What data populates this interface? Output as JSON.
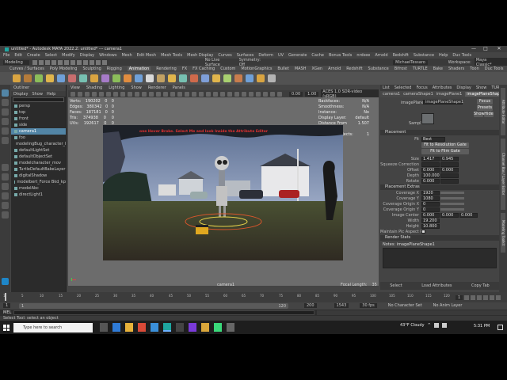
{
  "window": {
    "title": "untitled* - Autodesk MAYA 2022.2: untitled* --- camera1",
    "minimize": "—",
    "maximize": "□",
    "close": "✕"
  },
  "menubar": [
    "File",
    "Edit",
    "Create",
    "Select",
    "Modify",
    "Display",
    "Windows",
    "Mesh",
    "Edit Mesh",
    "Mesh Tools",
    "Mesh Display",
    "Curves",
    "Surfaces",
    "Deform",
    "UV",
    "Generate",
    "Cache",
    "Bonus Tools",
    "nrdsee",
    "Arnold",
    "Redshift",
    "Substance",
    "Help",
    "Duc Tools"
  ],
  "statusline": {
    "mode": "Modeling",
    "live_surface": "No Live Surface",
    "symmetry": "Symmetry: Off",
    "account": "MichaelTessaro",
    "workspace_label": "Workspace:",
    "workspace_value": "Maya Classic*"
  },
  "shelf_tabs": [
    "Curves / Surfaces",
    "Poly Modeling",
    "Sculpting",
    "Rigging",
    "Animation",
    "Rendering",
    "FX",
    "FX Caching",
    "Custom",
    "MotionGraphics",
    "Bullet",
    "MASH",
    "XGen",
    "Arnold",
    "Redshift",
    "Substance",
    "Bifrost",
    "TURTLE",
    "Bake",
    "Shaders",
    "Toon",
    "Duc Tools"
  ],
  "active_shelf": "Animation",
  "shelf_icon_colors": [
    "#d9a441",
    "#b47b3a",
    "#8bbd5a",
    "#e0b54c",
    "#6fa0d8",
    "#c86e6e",
    "#77c1b2",
    "#d9a441",
    "#a67bc8",
    "#8bbd5a",
    "#e08c3f",
    "#6fa0d8",
    "#d9d9d9",
    "#c2a163",
    "#e0b54c",
    "#77c1b2",
    "#d06a4b",
    "#7f9fd8",
    "#e0b54c",
    "#a8d070",
    "#c87d4d",
    "#6fa0d8",
    "#d9a441",
    "#b4b4b4"
  ],
  "outliner": {
    "title": "Outliner",
    "menus": [
      "Display",
      "Show",
      "Help"
    ],
    "items": [
      {
        "label": "persp",
        "selected": false
      },
      {
        "label": "top",
        "selected": false
      },
      {
        "label": "front",
        "selected": false
      },
      {
        "label": "side",
        "selected": false
      },
      {
        "label": "camera1",
        "selected": true
      },
      {
        "label": "foo",
        "selected": false
      },
      {
        "label": "modelingBug_character_RIG",
        "selected": false
      },
      {
        "label": "defaultLightSet",
        "selected": false
      },
      {
        "label": "defaultObjectSet",
        "selected": false
      },
      {
        "label": "modelcharacter_mov",
        "selected": false
      },
      {
        "label": "TurtleDefaultBakeLayer",
        "selected": false
      },
      {
        "label": "digitalShadow",
        "selected": false
      },
      {
        "label": "modelbert_Force Bkd_kp",
        "selected": false
      },
      {
        "label": "modelAbc",
        "selected": false
      },
      {
        "label": "directLight1",
        "selected": false
      }
    ]
  },
  "viewport": {
    "menus": [
      "View",
      "Shading",
      "Lighting",
      "Show",
      "Renderer",
      "Panels"
    ],
    "hud_left": [
      {
        "label": "Verts:",
        "a": "190202",
        "b": "0",
        "c": "0"
      },
      {
        "label": "Edges:",
        "a": "380342",
        "b": "0",
        "c": "0"
      },
      {
        "label": "Faces:",
        "a": "187181",
        "b": "0",
        "c": "0"
      },
      {
        "label": "Tris:",
        "a": "374938",
        "b": "0",
        "c": "0"
      },
      {
        "label": "UVs:",
        "a": "192617",
        "b": "0",
        "c": "0"
      }
    ],
    "hud_right": [
      {
        "label": "Backfaces:",
        "value": "N/A"
      },
      {
        "label": "Smoothness:",
        "value": "N/A"
      },
      {
        "label": "Instance:",
        "value": "No"
      },
      {
        "label": "Display Layer:",
        "value": "default"
      },
      {
        "label": "Distance From Camera:",
        "value": "1.507"
      },
      {
        "label": "Selected Objects:",
        "value": "1"
      }
    ],
    "overlay_text": "one Hover Broke. Select Me and look Inside the Attribute Editor",
    "camera_label": "camera1",
    "focal_label": "Focal Length:",
    "focal_value": "35",
    "colorspace": "ACES 1.0 SDR-video (sRGB)",
    "exposure": "0.00",
    "gamma": "1.00"
  },
  "attribute_editor": {
    "top_tabs": [
      "List",
      "Selected",
      "Focus",
      "Attributes",
      "Display",
      "Show",
      "TURTLE",
      "Help"
    ],
    "node_tabs": [
      "camera1",
      "cameraShape1",
      "imagePlane1",
      "imagePlaneShape1"
    ],
    "active_node_tab": "imagePlaneShape1",
    "node_label": "imagePlane:",
    "node_value": "imagePlaneShape1",
    "focus_btn": "Focus",
    "presets_btn": "Presets",
    "show_btn": "Show",
    "hide_btn": "Hide",
    "sample_label": "Sample",
    "fit_label": "Fit",
    "fit_value": "Best",
    "fit_resolution_btn": "Fit to Resolution Gate",
    "fit_film_btn": "Fit to Film Gate",
    "placement_section": "Placement",
    "placement": [
      {
        "label": "Size",
        "v1": "1.417",
        "v2": "0.945"
      },
      {
        "label": "Squeeze Correction",
        "v1": "",
        "v2": ""
      },
      {
        "label": "Offset",
        "v1": "0.000",
        "v2": "0.000"
      },
      {
        "label": "Depth",
        "v1": "100.000",
        "v2": ""
      },
      {
        "label": "Rotate",
        "v1": "0.000",
        "v2": ""
      }
    ],
    "extras_section": "Placement Extras",
    "extras": [
      {
        "label": "Coverage X",
        "v1": "1920"
      },
      {
        "label": "Coverage Y",
        "v1": "1080"
      },
      {
        "label": "Coverage Origin X",
        "v1": "0"
      },
      {
        "label": "Coverage Origin Y",
        "v1": "0"
      }
    ],
    "center_label": "Image Center",
    "center": [
      "0.000",
      "0.000",
      "0.000"
    ],
    "width_label": "Width",
    "width_value": "19.200",
    "height_label": "Height",
    "height_value": "10.800",
    "maintain_label": "Maintain Pic Aspect Ratio",
    "render_section": "Render Stats",
    "notes_label": "Notes: imagePlaneShape1",
    "bottom_buttons": [
      "Select",
      "Load Attributes",
      "Copy Tab"
    ]
  },
  "side_tabs": [
    "Attribute Editor",
    "Channel Box / Layer Editor",
    "Modeling Toolkit"
  ],
  "timeline": {
    "ticks": [
      "1",
      "5",
      "10",
      "15",
      "20",
      "25",
      "30",
      "35",
      "40",
      "45",
      "50",
      "55",
      "60",
      "65",
      "70",
      "75",
      "80",
      "85",
      "90",
      "95",
      "100",
      "105",
      "110",
      "115",
      "120"
    ],
    "current_frame": "1"
  },
  "range": {
    "start": "1",
    "start_inner": "1",
    "end_inner": "120",
    "end": "200",
    "end2": "1543",
    "fps": "30 fps",
    "character_set": "No Character Set",
    "anim_layer": "No Anim Layer"
  },
  "cmdline": {
    "lang": "MEL",
    "help": "Select Tool: select an object"
  },
  "taskbar": {
    "search_placeholder": "Type here to search",
    "weather": "43°F Cloudy",
    "time": "5:31 PM",
    "date": "4/11/2022"
  }
}
